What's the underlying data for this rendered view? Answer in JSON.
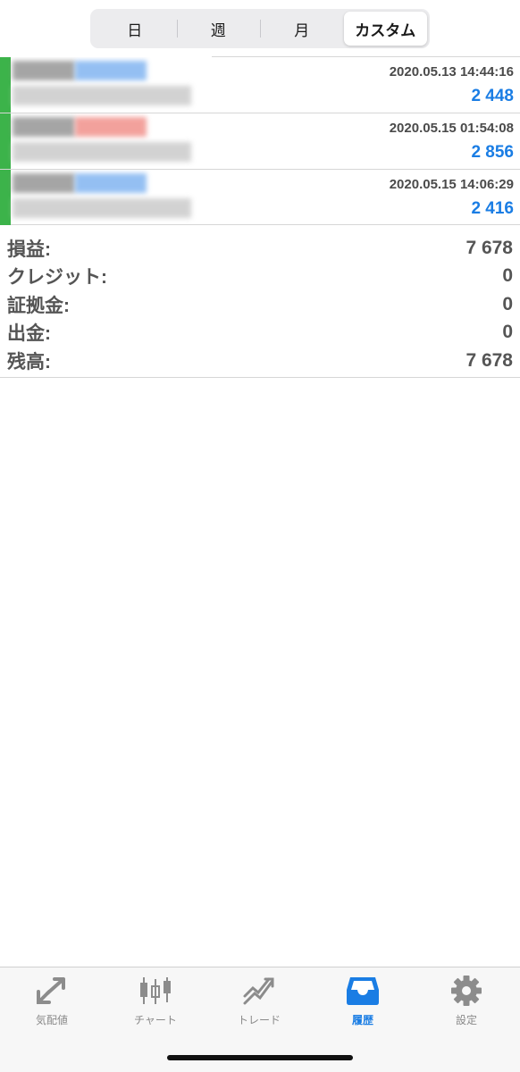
{
  "segment": {
    "items": [
      "日",
      "週",
      "月",
      "カスタム"
    ],
    "active": "カスタム"
  },
  "deals": [
    {
      "time": "2020.05.13 14:44:16",
      "amount": "2 448"
    },
    {
      "time": "2020.05.15 01:54:08",
      "amount": "2 856"
    },
    {
      "time": "2020.05.15 14:06:29",
      "amount": "2 416"
    }
  ],
  "summary": {
    "profit_label": "損益:",
    "profit_value": "7 678",
    "credit_label": "クレジット:",
    "credit_value": "0",
    "margin_label": "証拠金:",
    "margin_value": "0",
    "withdrawal_label": "出金:",
    "withdrawal_value": "0",
    "balance_label": "残高:",
    "balance_value": "7 678"
  },
  "tabbar": {
    "items": [
      {
        "label": "気配値",
        "icon": "quotes-icon"
      },
      {
        "label": "チャート",
        "icon": "chart-icon"
      },
      {
        "label": "トレード",
        "icon": "trade-icon"
      },
      {
        "label": "履歴",
        "icon": "history-icon"
      },
      {
        "label": "設定",
        "icon": "settings-icon"
      }
    ],
    "active": "履歴"
  },
  "colors": {
    "accent": "#1a7de4",
    "positive": "#3cb34a",
    "negative": "#e74c3c"
  }
}
